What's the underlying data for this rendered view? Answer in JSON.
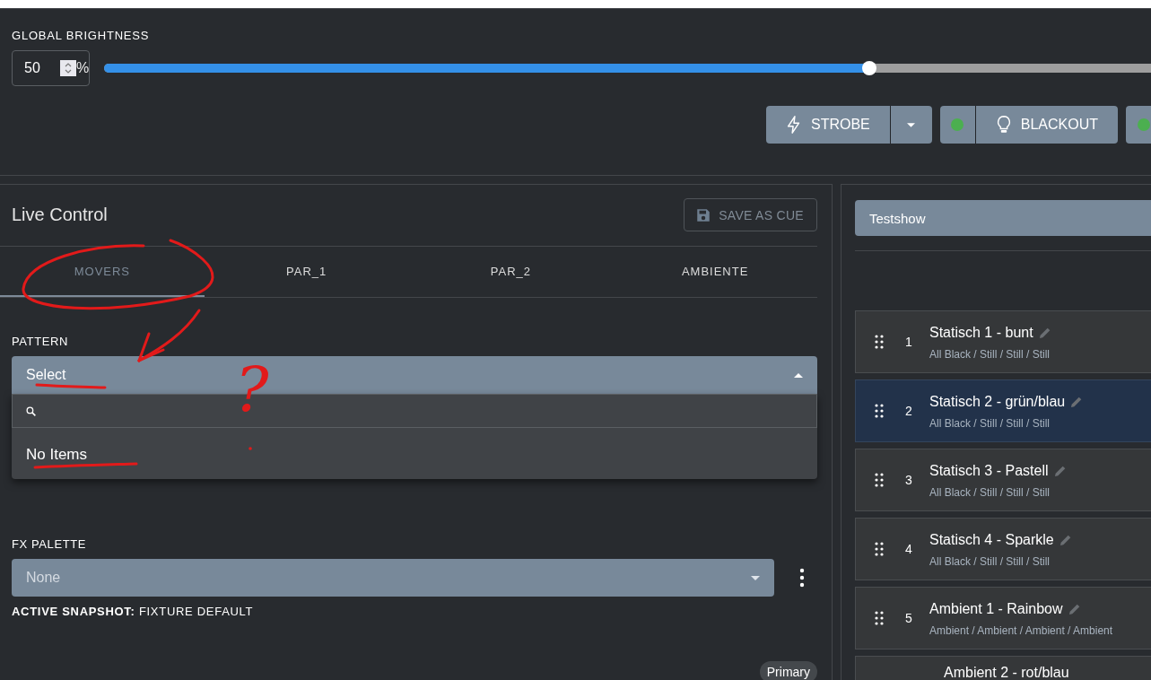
{
  "global_brightness": {
    "label": "GLOBAL BRIGHTNESS",
    "value": "50",
    "unit": "%",
    "level": 0.5
  },
  "actions": [
    {
      "kind": "split",
      "label": "STROBE"
    },
    {
      "kind": "toggle",
      "label": "BLACKOUT",
      "on": true
    },
    {
      "kind": "toggle",
      "on": true
    }
  ],
  "live_control": {
    "title": "Live Control",
    "save_button": "SAVE AS CUE",
    "tabs": [
      {
        "label": "MOVERS",
        "selected": true
      },
      {
        "label": "PAR_1",
        "selected": false
      },
      {
        "label": "PAR_2",
        "selected": false
      },
      {
        "label": "AMBIENTE",
        "selected": false
      }
    ],
    "pattern": {
      "label": "PATTERN",
      "value": "Select",
      "expanded": true,
      "menu_empty": "No Items"
    },
    "fx_palette": {
      "label": "FX PALETTE",
      "value": "None",
      "expanded": false
    },
    "active_snapshot": "**ACTIVE SNAPSHOT:** FIXTURE DEFAULT",
    "chip": "Primary"
  },
  "show": {
    "title": "Testshow",
    "cues": [
      {
        "number": "1",
        "title": "Statisch 1 - bunt",
        "subtitle": "All Black / Still / Still / Still",
        "selected": false
      },
      {
        "number": "2",
        "title": "Statisch 2 - grün/blau",
        "subtitle": "All Black / Still / Still / Still",
        "selected": true
      },
      {
        "number": "3",
        "title": "Statisch 3 - Pastell",
        "subtitle": "All Black / Still / Still / Still",
        "selected": false
      },
      {
        "number": "4",
        "title": "Statisch 4 - Sparkle",
        "subtitle": "All Black / Still / Still / Still",
        "selected": false
      },
      {
        "number": "5",
        "title": "Ambient 1 - Rainbow",
        "subtitle": "Ambient / Ambient / Ambient / Ambient",
        "selected": false
      },
      {
        "title": "Ambient 2 - rot/blau",
        "selected": false
      }
    ]
  },
  "annotation": {
    "mark": "?"
  }
}
